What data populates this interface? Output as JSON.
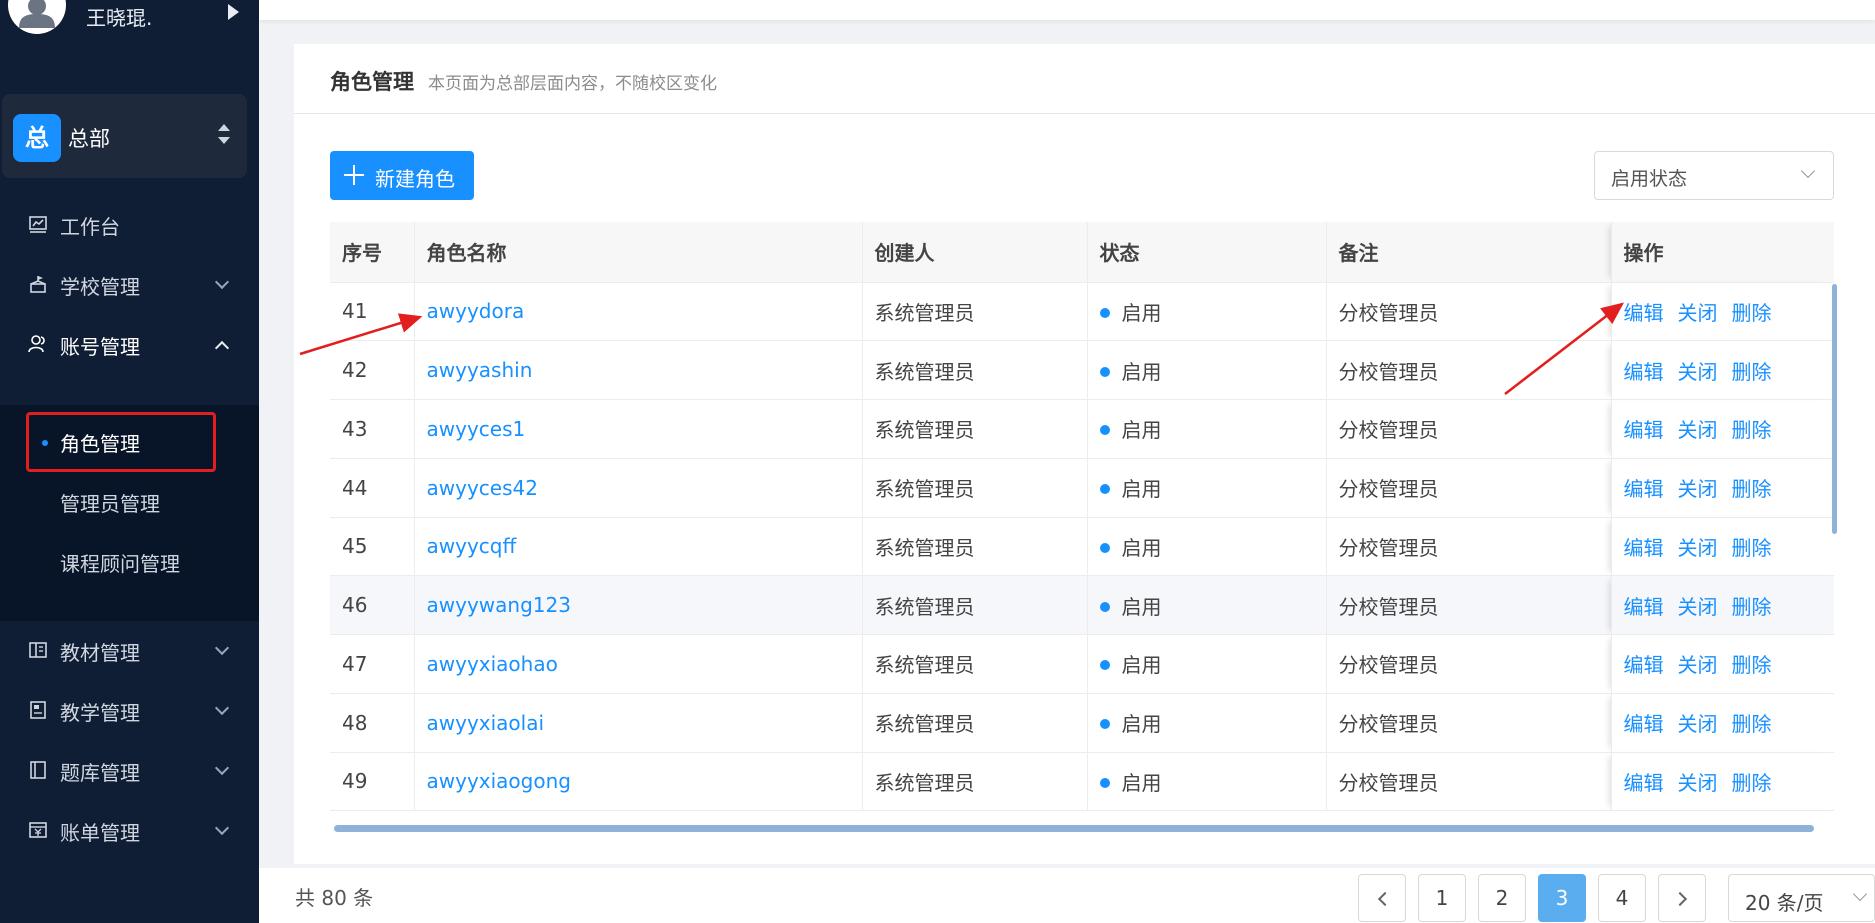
{
  "user": {
    "name": "王晓琨."
  },
  "org": {
    "badge": "总",
    "name": "总部"
  },
  "menu": {
    "workbench": "工作台",
    "school": "学校管理",
    "account": "账号管理",
    "account_sub": [
      "角色管理",
      "管理员管理",
      "课程顾问管理"
    ],
    "materials": "教材管理",
    "teaching": "教学管理",
    "questions": "题库管理",
    "billing": "账单管理"
  },
  "page": {
    "title": "角色管理",
    "desc": "本页面为总部层面内容，不随校区变化",
    "new_button": "新建角色",
    "status_filter": "启用状态"
  },
  "table": {
    "columns": [
      "序号",
      "角色名称",
      "创建人",
      "状态",
      "备注",
      "操作"
    ],
    "actions": [
      "编辑",
      "关闭",
      "删除"
    ],
    "rows": [
      {
        "no": "41",
        "name": "awyydora",
        "creator": "系统管理员",
        "status": "启用",
        "note": "分校管理员"
      },
      {
        "no": "42",
        "name": "awyyashin",
        "creator": "系统管理员",
        "status": "启用",
        "note": "分校管理员"
      },
      {
        "no": "43",
        "name": "awyyces1",
        "creator": "系统管理员",
        "status": "启用",
        "note": "分校管理员"
      },
      {
        "no": "44",
        "name": "awyyces42",
        "creator": "系统管理员",
        "status": "启用",
        "note": "分校管理员"
      },
      {
        "no": "45",
        "name": "awyycqff",
        "creator": "系统管理员",
        "status": "启用",
        "note": "分校管理员"
      },
      {
        "no": "46",
        "name": "awyywang123",
        "creator": "系统管理员",
        "status": "启用",
        "note": "分校管理员"
      },
      {
        "no": "47",
        "name": "awyyxiaohao",
        "creator": "系统管理员",
        "status": "启用",
        "note": "分校管理员"
      },
      {
        "no": "48",
        "name": "awyyxiaolai",
        "creator": "系统管理员",
        "status": "启用",
        "note": "分校管理员"
      },
      {
        "no": "49",
        "name": "awyyxiaogong",
        "creator": "系统管理员",
        "status": "启用",
        "note": "分校管理员"
      }
    ]
  },
  "pagination": {
    "total": "共 80 条",
    "pages": [
      "1",
      "2",
      "3",
      "4"
    ],
    "current": "3",
    "page_size": "20 条/页"
  },
  "colors": {
    "accent": "#1890ff",
    "sidebar": "#0f1e34",
    "annotation": "#e21e1e"
  }
}
